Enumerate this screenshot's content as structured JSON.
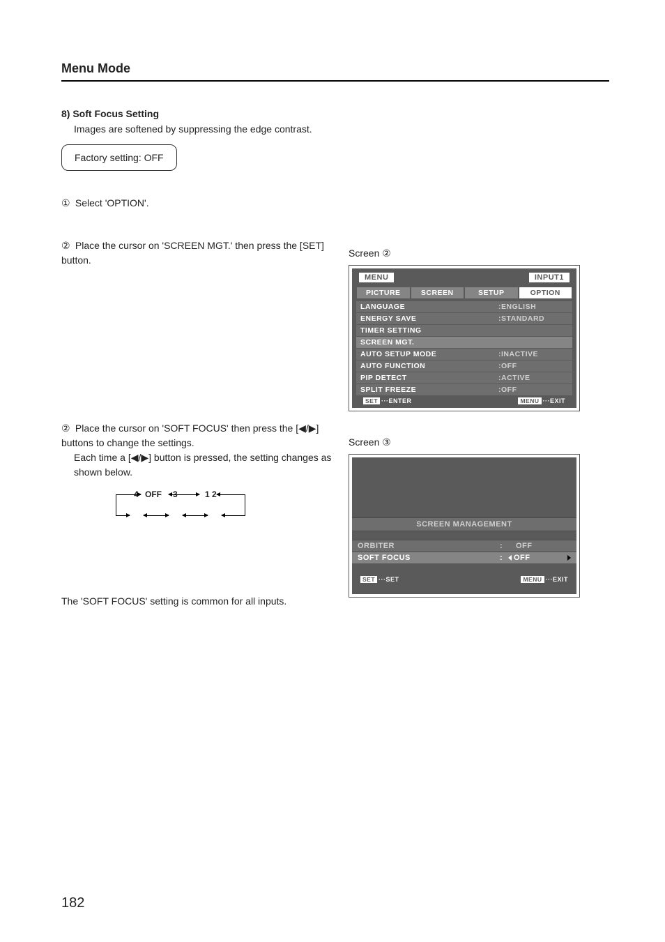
{
  "page": {
    "section_title": "Menu Mode",
    "subheading": "8) Soft Focus Setting",
    "description": "Images are softened by suppressing the edge contrast.",
    "factory_setting": "Factory setting: OFF",
    "step1_num": "①",
    "step1_text": "Select 'OPTION'.",
    "step2_num": "②",
    "step2_text": "Place the cursor on 'SCREEN MGT.' then press the [SET] button.",
    "step3_num": "②",
    "step3_text1": "Place the cursor on 'SOFT FOCUS' then press the [◀/▶] buttons to change the settings.",
    "step3_text2": "Each time a [◀/▶] button is pressed, the setting changes as shown below.",
    "cycle": {
      "n0": "OFF",
      "n1": "1",
      "n2": "2",
      "n3": "3",
      "n4": "4"
    },
    "common_note": "The 'SOFT FOCUS' setting is common for all inputs.",
    "page_number": "182"
  },
  "screen2": {
    "label": "Screen ②",
    "menu_badge": "MENU",
    "input_badge": "INPUT1",
    "tabs": [
      "PICTURE",
      "SCREEN",
      "SETUP",
      "OPTION"
    ],
    "rows": [
      {
        "label": "LANGUAGE",
        "value": ":ENGLISH"
      },
      {
        "label": "ENERGY SAVE",
        "value": ":STANDARD"
      },
      {
        "label": "TIMER SETTING",
        "value": ""
      },
      {
        "label": "SCREEN MGT.",
        "value": "",
        "selected": true
      },
      {
        "label": "AUTO SETUP MODE",
        "value": ":INACTIVE"
      },
      {
        "label": "AUTO FUNCTION",
        "value": ":OFF"
      },
      {
        "label": "PIP DETECT",
        "value": ":ACTIVE"
      },
      {
        "label": "SPLIT FREEZE",
        "value": ":OFF"
      }
    ],
    "hint_left_box": "SET",
    "hint_left": "···ENTER",
    "hint_right_box": "MENU",
    "hint_right": "···EXIT"
  },
  "screen3": {
    "label": "Screen ③",
    "title": "SCREEN MANAGEMENT",
    "rows": [
      {
        "label": "ORBITER",
        "value": "OFF",
        "selected": false
      },
      {
        "label": "SOFT FOCUS",
        "value": "OFF",
        "selected": true
      }
    ],
    "hint_left_box": "SET",
    "hint_left": "···SET",
    "hint_right_box": "MENU",
    "hint_right": "···EXIT"
  }
}
